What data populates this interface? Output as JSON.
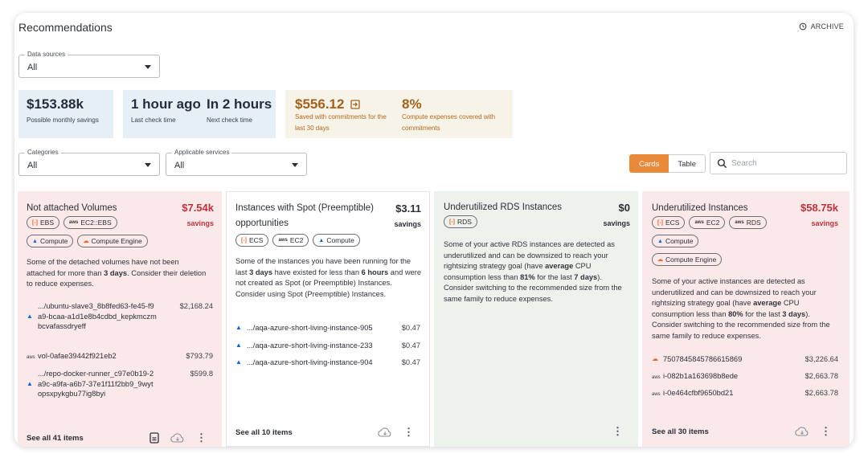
{
  "header": {
    "title": "Recommendations",
    "archive_label": "ARCHIVE"
  },
  "filters": {
    "data_sources": {
      "label": "Data sources",
      "value": "All"
    },
    "categories": {
      "label": "Categories",
      "value": "All"
    },
    "applicable_services": {
      "label": "Applicable services",
      "value": "All"
    }
  },
  "stats": {
    "possible_savings": {
      "value": "$153.88k",
      "label": "Possible monthly savings"
    },
    "last_check": {
      "value": "1 hour ago",
      "label": "Last check time"
    },
    "next_check": {
      "value": "In 2 hours",
      "label": "Next check time"
    },
    "commitments_saved": {
      "value": "$556.12",
      "label": "Saved with commitments for the last 30 days"
    },
    "compute_covered": {
      "value": "8%",
      "label": "Compute expenses covered with commitments"
    }
  },
  "view_toggle": {
    "cards": "Cards",
    "table": "Table",
    "active": "Cards"
  },
  "search": {
    "placeholder": "Search"
  },
  "cards": [
    {
      "title": "Not attached Volumes",
      "amount": "$7.54k",
      "savings_label": "savings",
      "chips": [
        "EBS",
        "EC2::EBS",
        "Compute",
        "Compute Engine"
      ],
      "description_parts": [
        "Some of the detached volumes have not been attached for more than ",
        "3 days",
        ". Consider their deletion to reduce expenses."
      ],
      "items": [
        {
          "icon": "azure-icon",
          "name": ".../ubuntu-slave3_8b8fed63-fe45-f9a9-bcaa-a1d1e8b4cdbd_kepkmczmbcvafassdryeff",
          "cost": "$2,168.24"
        },
        {
          "icon": "aws-icon",
          "name": "vol-0afae39442f921eb2",
          "cost": "$793.79"
        },
        {
          "icon": "azure-icon",
          "name": ".../repo-docker-runner_c97e0b19-2a9c-a9fa-a6b7-37e1f11f2bb9_9wytopsxpykgbu77ig8byi",
          "cost": "$599.8"
        }
      ],
      "see_all": "See all 41 items",
      "bg": "#fbe9ea"
    },
    {
      "title": "Instances with Spot (Preemptible) opportunities",
      "amount": "$3.11",
      "savings_label": "savings",
      "chips": [
        "ECS",
        "EC2",
        "Compute"
      ],
      "description_parts": [
        "Some of the instances you have been running for the last ",
        "3 days",
        " have existed for less than ",
        "6 hours",
        " and were not created as Spot (or Preemptible) Instances. Consider using Spot (Preemptible) Instances."
      ],
      "items": [
        {
          "icon": "azure-icon",
          "name": ".../aqa-azure-short-living-instance-905",
          "cost": "$0.47"
        },
        {
          "icon": "azure-icon",
          "name": ".../aqa-azure-short-living-instance-233",
          "cost": "$0.47"
        },
        {
          "icon": "azure-icon",
          "name": ".../aqa-azure-short-living-instance-904",
          "cost": "$0.47"
        }
      ],
      "see_all": "See all 10 items",
      "bg": "#ffffff"
    },
    {
      "title": "Underutilized RDS Instances",
      "amount": "$0",
      "savings_label": "savings",
      "chips": [
        "RDS"
      ],
      "description_parts": [
        "Some of your active RDS instances are detected as underutilized and can be downsized to reach your rightsizing strategy goal (have ",
        "average",
        " CPU consumption less than ",
        "81%",
        " for the last ",
        "7 days",
        "). Consider switching to the recommended size from the same family to reduce expenses."
      ],
      "items": [],
      "see_all": "",
      "bg": "#ecf2ec"
    },
    {
      "title": "Underutilized Instances",
      "amount": "$58.75k",
      "savings_label": "savings",
      "chips": [
        "ECS",
        "EC2",
        "RDS",
        "Compute",
        "Compute Engine"
      ],
      "description_parts": [
        "Some of your active instances are detected as underutilized and can be downsized to reach your rightsizing strategy goal (have ",
        "average",
        " CPU consumption less than ",
        "80%",
        " for the last ",
        "3 days",
        "). Consider switching to the recommended size from the same family to reduce expenses."
      ],
      "items": [
        {
          "icon": "gcp-icon",
          "name": "7507845845786615869",
          "cost": "$3,226.64"
        },
        {
          "icon": "aws-icon",
          "name": "i-082b1a163698b8ede",
          "cost": "$2,663.78"
        },
        {
          "icon": "aws-icon",
          "name": "i-0e464cfbf9650bd21",
          "cost": "$2,663.78"
        }
      ],
      "see_all": "See all 30 items",
      "bg": "#fbe9ea"
    }
  ],
  "colors": {
    "accent": "#e98a3a",
    "danger": "#c0323a",
    "stat_blue": "#e6eef6",
    "stat_tan": "#f6f3e8"
  },
  "icon_glyphs": {
    "aws": "aws",
    "azure": "▲",
    "gcp": "☁",
    "amazon_service": "[-]"
  }
}
